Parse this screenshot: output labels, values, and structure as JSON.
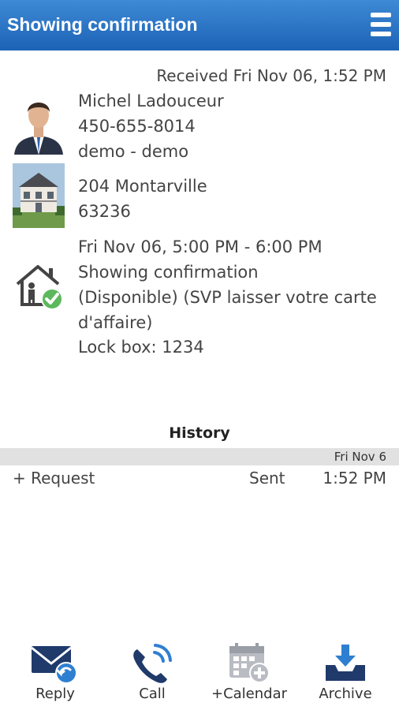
{
  "header": {
    "title": "Showing confirmation",
    "menu_icon": "hamburger-menu-icon"
  },
  "message": {
    "received": "Received Fri Nov 06, 1:52 PM",
    "contact": {
      "name": "Michel Ladouceur",
      "phone": "450-655-8014",
      "company": "demo - demo"
    },
    "property": {
      "address": "204 Montarville",
      "code": "63236"
    },
    "showing": {
      "time": "Fri Nov 06, 5:00 PM - 6:00 PM",
      "status": "Showing confirmation",
      "note_line1": "(Disponible) (SVP laisser votre carte",
      "note_line2": "d'affaire)",
      "lockbox": "Lock box: 1234"
    }
  },
  "history": {
    "title": "History",
    "date": "Fri Nov 6",
    "rows": [
      {
        "action": "+ Request",
        "status": "Sent",
        "time": "1:52 PM"
      }
    ]
  },
  "actions": [
    {
      "label": "Reply",
      "icon": "reply-mail-icon"
    },
    {
      "label": "Call",
      "icon": "phone-icon"
    },
    {
      "label": "+Calendar",
      "icon": "calendar-add-icon"
    },
    {
      "label": "Archive",
      "icon": "archive-tray-icon"
    }
  ],
  "colors": {
    "header_top": "#3e8ad6",
    "header_bottom": "#1c62b5",
    "icon_navy": "#1f3a6b",
    "icon_blue": "#2f7fd0",
    "check_green": "#5cb85c",
    "history_band": "#e1e1e1"
  }
}
